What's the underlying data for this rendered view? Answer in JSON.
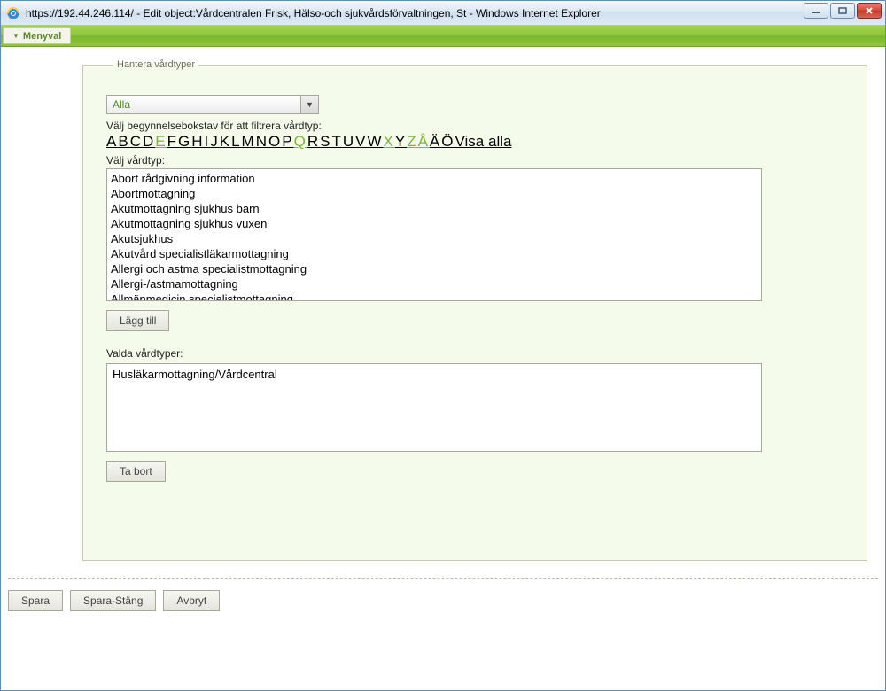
{
  "window": {
    "title": "https://192.44.246.114/ - Edit object:Vårdcentralen Frisk, Hälso-och sjukvårdsförvaltningen, St - Windows Internet Explorer"
  },
  "menubar": {
    "menyval": "Menyval"
  },
  "panel": {
    "legend": "Hantera vårdtyper",
    "dropdown_value": "Alla",
    "filter_label": "Välj begynnelsebokstav för att filtrera vårdtyp:",
    "alpha": {
      "A": "A",
      "B": "B",
      "C": "C",
      "D": "D",
      "E": "E",
      "F": "F",
      "G": "G",
      "H": "H",
      "I": "I",
      "J": "J",
      "K": "K",
      "L": "L",
      "M": "M",
      "N": "N",
      "O": "O",
      "P": "P",
      "Q": "Q",
      "R": "R",
      "S": "S",
      "T": "T",
      "U": "U",
      "V": "V",
      "W": "W",
      "X": "X",
      "Y": "Y",
      "Z": "Z",
      "Aring": "Å",
      "Auml": "Ä",
      "Ouml": "Ö",
      "all": "Visa alla"
    },
    "list_label": "Välj vårdtyp:",
    "items": [
      "Abort rådgivning information",
      "Abortmottagning",
      "Akutmottagning sjukhus barn",
      "Akutmottagning sjukhus vuxen",
      "Akutsjukhus",
      "Akutvård specialistläkarmottagning",
      "Allergi och astma specialistmottagning",
      "Allergi-/astmamottagning",
      "Allmänmedicin specialistmottagning"
    ],
    "add_button": "Lägg till",
    "selected_label": "Valda vårdtyper:",
    "selected_items": [
      "Husläkarmottagning/Vårdcentral"
    ],
    "remove_button": "Ta bort"
  },
  "footer": {
    "save": "Spara",
    "save_close": "Spara-Stäng",
    "cancel": "Avbryt"
  }
}
